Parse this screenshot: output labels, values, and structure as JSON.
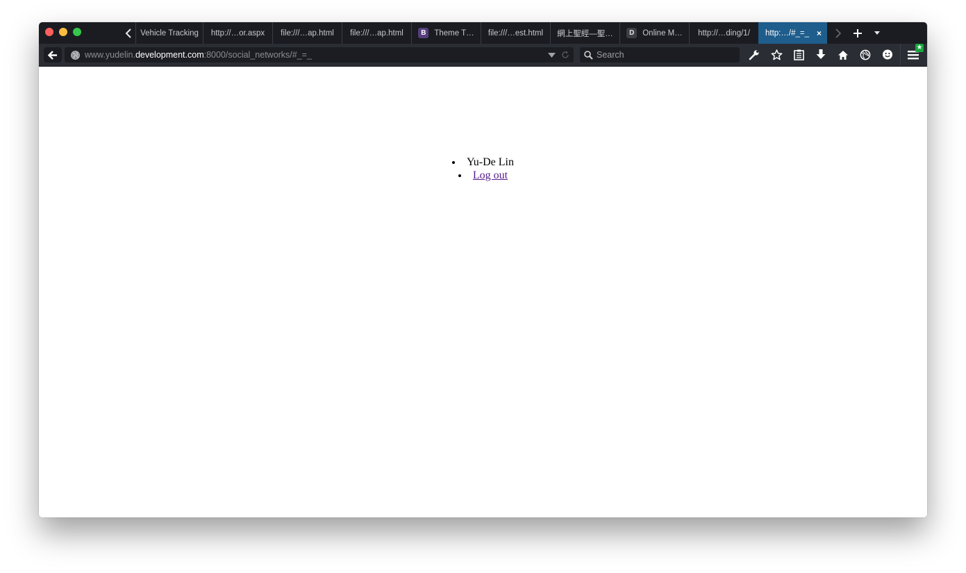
{
  "browser": {
    "tabs": [
      {
        "label": "Vehicle Tracking",
        "favicon": ""
      },
      {
        "label": "http://…or.aspx",
        "favicon": ""
      },
      {
        "label": "file:///…ap.html",
        "favicon": ""
      },
      {
        "label": "file:///…ap.html",
        "favicon": ""
      },
      {
        "label": "Theme T…",
        "favicon": "B"
      },
      {
        "label": "file:///…est.html",
        "favicon": ""
      },
      {
        "label": "網上聖經—聖…",
        "favicon": ""
      },
      {
        "label": "Online M…",
        "favicon": "D"
      },
      {
        "label": "http://…ding/1/",
        "favicon": ""
      },
      {
        "label": "http:…/#_=_",
        "favicon": "",
        "active": true
      }
    ],
    "tab_close_glyph": "×",
    "new_tab_glyph": "+",
    "url": {
      "prefix": "www.yudelin.",
      "host": "development.com",
      "suffix": ":8000/social_networks/#_=_"
    },
    "search": {
      "placeholder": "Search",
      "value": ""
    }
  },
  "page": {
    "menu_items": [
      {
        "label": "Yu-De Lin",
        "is_link": false
      },
      {
        "label": "Log out",
        "is_link": true
      }
    ]
  },
  "colors": {
    "tabstrip_bg": "#1a1c21",
    "active_tab": "#1f5d8c",
    "toolbar_bg": "#2a2d33",
    "visited_link": "#551a8b"
  }
}
